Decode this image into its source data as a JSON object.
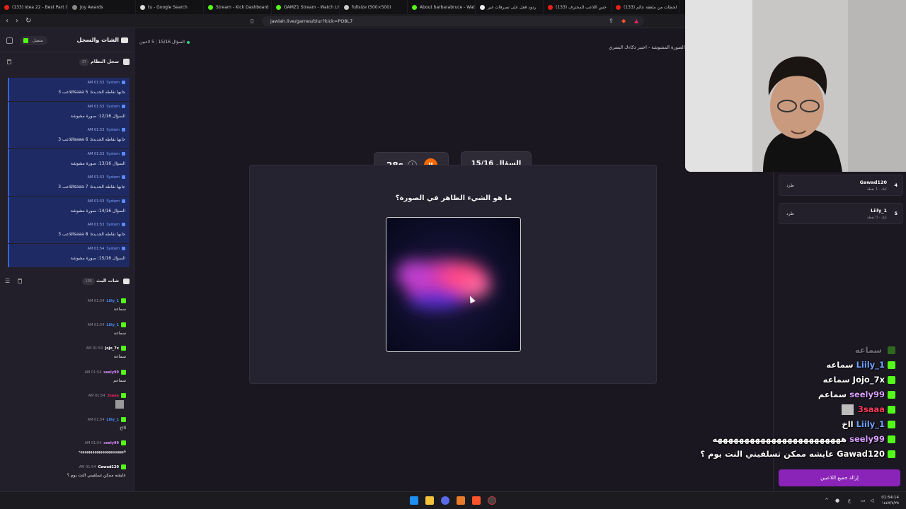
{
  "browser": {
    "tabs": [
      {
        "label": "(133) Idea 22 - Best Part 0",
        "color": "#e62117"
      },
      {
        "label": "Joy Awards",
        "color": "#888888"
      },
      {
        "label": "tu - Google Search",
        "color": "#dddddd"
      },
      {
        "label": "Stream - Kick Dashboard",
        "color": "#53fc18"
      },
      {
        "label": "OAMZ1 Stream - Watch Live",
        "color": "#53fc18"
      },
      {
        "label": "fullsize (500×500)",
        "color": "#cccccc"
      },
      {
        "label": "About barbarabruce - Watch",
        "color": "#53fc18"
      },
      {
        "label": "ردود فعل على تصرفات غير",
        "color": "#eeeeee"
      },
      {
        "label": "(133) خس اللاعب المحترف",
        "color": "#e62117"
      },
      {
        "label": "(133) لحظات من ملعقة عالم",
        "color": "#e62117"
      }
    ],
    "url": "jawlah.live/games/blur?kick=PO8L7"
  },
  "sidebar": {
    "title": "الشات والسجل",
    "status": "متصل",
    "system_log": {
      "title": "سجل النظام",
      "count": "37",
      "items": [
        {
          "time": "AM 01:53",
          "sender": "System",
          "text": "اللاعب 3saaa جابها نقاطه الجديدة: 5"
        },
        {
          "time": "AM 01:53",
          "sender": "System",
          "text": "السؤال 12/16: صورة مشوشة"
        },
        {
          "time": "AM 01:53",
          "sender": "System",
          "text": "اللاعب 3saaa جابها نقاطه الجديدة: 6"
        },
        {
          "time": "AM 01:53",
          "sender": "System",
          "text": "السؤال 13/16: صورة مشوشة"
        },
        {
          "time": "AM 01:53",
          "sender": "System",
          "text": "اللاعب 3saaa جابها نقاطه الجديدة: 7"
        },
        {
          "time": "AM 01:53",
          "sender": "System",
          "text": "السؤال 14/16: صورة مشوشة"
        },
        {
          "time": "AM 01:53",
          "sender": "System",
          "text": "اللاعب 3saaa جابها نقاطه الجديدة: 8"
        },
        {
          "time": "AM 01:54",
          "sender": "System",
          "text": "السؤال 15/16: صورة مشوشة"
        }
      ]
    },
    "stream_chat": {
      "title": "شات البث",
      "count": "105",
      "messages": [
        {
          "time": "AM 01:54",
          "user": "Liily_1",
          "color": "#4b8bf5",
          "text": "سماعة"
        },
        {
          "time": "AM 01:54",
          "user": "Liily_1",
          "color": "#4b8bf5",
          "text": "سماعه"
        },
        {
          "time": "AM 01:54",
          "user": "Jojo_7x",
          "color": "#ffffff",
          "text": "سماعه"
        },
        {
          "time": "AM 01:54",
          "user": "seely99",
          "color": "#d88cff",
          "text": "سماعم"
        },
        {
          "time": "AM 01:54",
          "user": "3saaa",
          "color": "#e0245e",
          "text": ""
        },
        {
          "time": "AM 01:54",
          "user": "Liily_1",
          "color": "#4b8bf5",
          "text": "اااخ"
        },
        {
          "time": "AM 01:54",
          "user": "seely99",
          "color": "#d88cff",
          "text": "هههههههههههههههههههههههه"
        },
        {
          "time": "AM 01:54",
          "user": "Gawad120",
          "color": "#ffffff",
          "text": "عايشه ممكن تسلفيني النت يوم ؟"
        }
      ]
    }
  },
  "game": {
    "players_online": "5 لاعبين",
    "question_label": "السؤال 15/16",
    "subtitle": "الصورة المشوشة - اختبر ذكاءك البصري!",
    "timer": "28s",
    "question_badge": "السؤال 15/16",
    "question": "ما هو الشيء الظاهر في الصورة؟"
  },
  "players": [
    {
      "rank": "4",
      "name": "Gawad120",
      "sub": "كيك · 1 نقطة",
      "kick": "طرد"
    },
    {
      "rank": "5",
      "name": "Liily_1",
      "sub": "كيك · 0 نقطة",
      "kick": "طرد"
    }
  ],
  "overlay_chat": [
    {
      "user": "",
      "color": "#888888",
      "text": "سماعه"
    },
    {
      "user": "Liily_1",
      "color": "#6fa3ff",
      "text": "سماعه"
    },
    {
      "user": "Jojo_7x",
      "color": "#ffffff",
      "text": "سماعه"
    },
    {
      "user": "seely99",
      "color": "#d9a0ff",
      "text": "سماعم"
    },
    {
      "user": "3saaa",
      "color": "#ff3b5c",
      "text": ""
    },
    {
      "user": "Liily_1",
      "color": "#6fa3ff",
      "text": "ااخ"
    },
    {
      "user": "seely99",
      "color": "#d9a0ff",
      "text": "ههههههههههههههههههههههههه"
    },
    {
      "user": "Gawad120",
      "color": "#ffffff",
      "text": "عايشه ممكن تسلفيني النت يوم ؟"
    }
  ],
  "remove_all_button": "إزالة جميع اللاعبين",
  "taskbar": {
    "time": "01:54:14",
    "date": "١٤٤٧/٧/٢٥"
  }
}
